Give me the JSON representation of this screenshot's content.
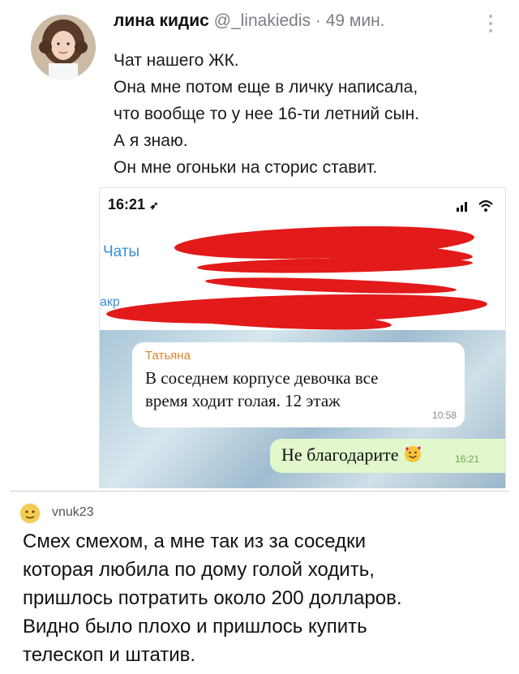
{
  "tweet": {
    "author_name": "лина кидис",
    "handle": "@_linakiedis",
    "separator": "·",
    "time": "49 мин.",
    "lines": [
      "Чат нашего ЖК.",
      "Она мне потом еще в личку написала,",
      "что вообще то у нее 16-ти летний сын.",
      "А я знаю.",
      "Он мне огоньки на сторис ставит."
    ]
  },
  "screenshot": {
    "status_time": "16:21",
    "chats_label": "Чаты",
    "pinned_label": "акр",
    "incoming": {
      "sender": "Татьяна",
      "lines": [
        "В соседнем корпусе девочка все",
        "время ходит голая. 12 этаж"
      ],
      "time": "10:58"
    },
    "outgoing": {
      "text": "Не благодарите",
      "time": "16:21"
    },
    "colors": {
      "accent": "#3b8fd6",
      "redaction": "#e21a1a",
      "outgoing_bubble": "#e2f7cc"
    }
  },
  "comment": {
    "username": "vnuk23",
    "lines": [
      "Смех смехом, а мне так из за соседки",
      "которая любила по дому голой ходить,",
      "пришлось потратить около 200 долларов.",
      "Видно было плохо и пришлось купить",
      "телескоп и штатив."
    ]
  }
}
